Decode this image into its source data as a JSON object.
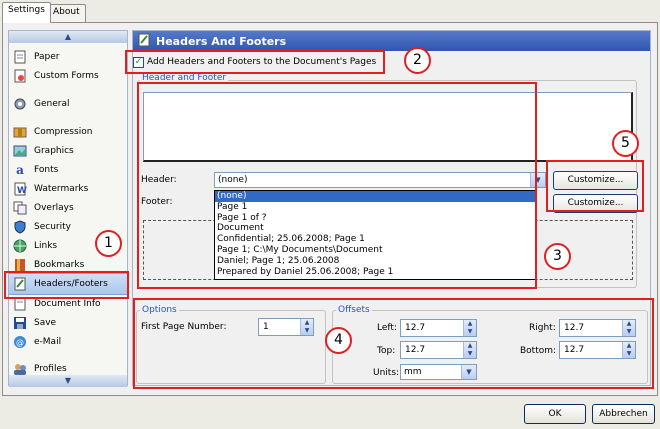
{
  "tabs": [
    {
      "label": "Settings"
    },
    {
      "label": "About"
    }
  ],
  "sidebar": {
    "scroll_up": "▲",
    "scroll_down": "▼",
    "items": [
      {
        "label": "Paper",
        "icon": "paper-icon"
      },
      {
        "label": "Custom Forms",
        "icon": "custom-forms-icon"
      },
      {
        "label": "General",
        "icon": "general-icon"
      },
      {
        "label": "Compression",
        "icon": "compression-icon"
      },
      {
        "label": "Graphics",
        "icon": "graphics-icon"
      },
      {
        "label": "Fonts",
        "icon": "fonts-icon"
      },
      {
        "label": "Watermarks",
        "icon": "watermarks-icon"
      },
      {
        "label": "Overlays",
        "icon": "overlays-icon"
      },
      {
        "label": "Security",
        "icon": "security-icon"
      },
      {
        "label": "Links",
        "icon": "links-icon"
      },
      {
        "label": "Bookmarks",
        "icon": "bookmarks-icon"
      },
      {
        "label": "Headers/Footers",
        "icon": "headers-footers-icon",
        "selected": true
      },
      {
        "label": "Document Info",
        "icon": "document-info-icon"
      },
      {
        "label": "Save",
        "icon": "save-icon"
      },
      {
        "label": "e-Mail",
        "icon": "email-icon"
      },
      {
        "label": "Profiles",
        "icon": "profiles-icon"
      }
    ]
  },
  "panel": {
    "title": "Headers And Footers",
    "add_checkbox_label": "Add Headers and Footers to the Document's Pages",
    "add_checked": true,
    "hf_group_title": "Header and Footer",
    "header_label": "Header:",
    "header_value": "(none)",
    "footer_label": "Footer:",
    "customize_header": "Customize...",
    "customize_footer": "Customize...",
    "dropdown_options": [
      "(none)",
      "Page 1",
      "Page 1 of ?",
      "Document",
      "Confidential; 25.06.2008; Page 1",
      "Page 1; C:\\My Documents\\Document",
      "Daniel; Page 1; 25.06.2008",
      "Prepared by Daniel 25.06.2008; Page 1"
    ],
    "options_group_title": "Options",
    "first_page_label": "First Page Number:",
    "first_page_value": "1",
    "offsets_group_title": "Offsets",
    "left_label": "Left:",
    "left_value": "12.7",
    "top_label": "Top:",
    "top_value": "12.7",
    "right_label": "Right:",
    "right_value": "12.7",
    "bottom_label": "Bottom:",
    "bottom_value": "12.7",
    "units_label": "Units:",
    "units_value": "mm"
  },
  "callouts": [
    "1",
    "2",
    "3",
    "4",
    "5"
  ],
  "footer_buttons": {
    "ok": "OK",
    "cancel": "Abbrechen"
  },
  "colors": {
    "highlight": "#e02020",
    "title_bar": "#3a60b8",
    "selection": "#316ac5"
  }
}
